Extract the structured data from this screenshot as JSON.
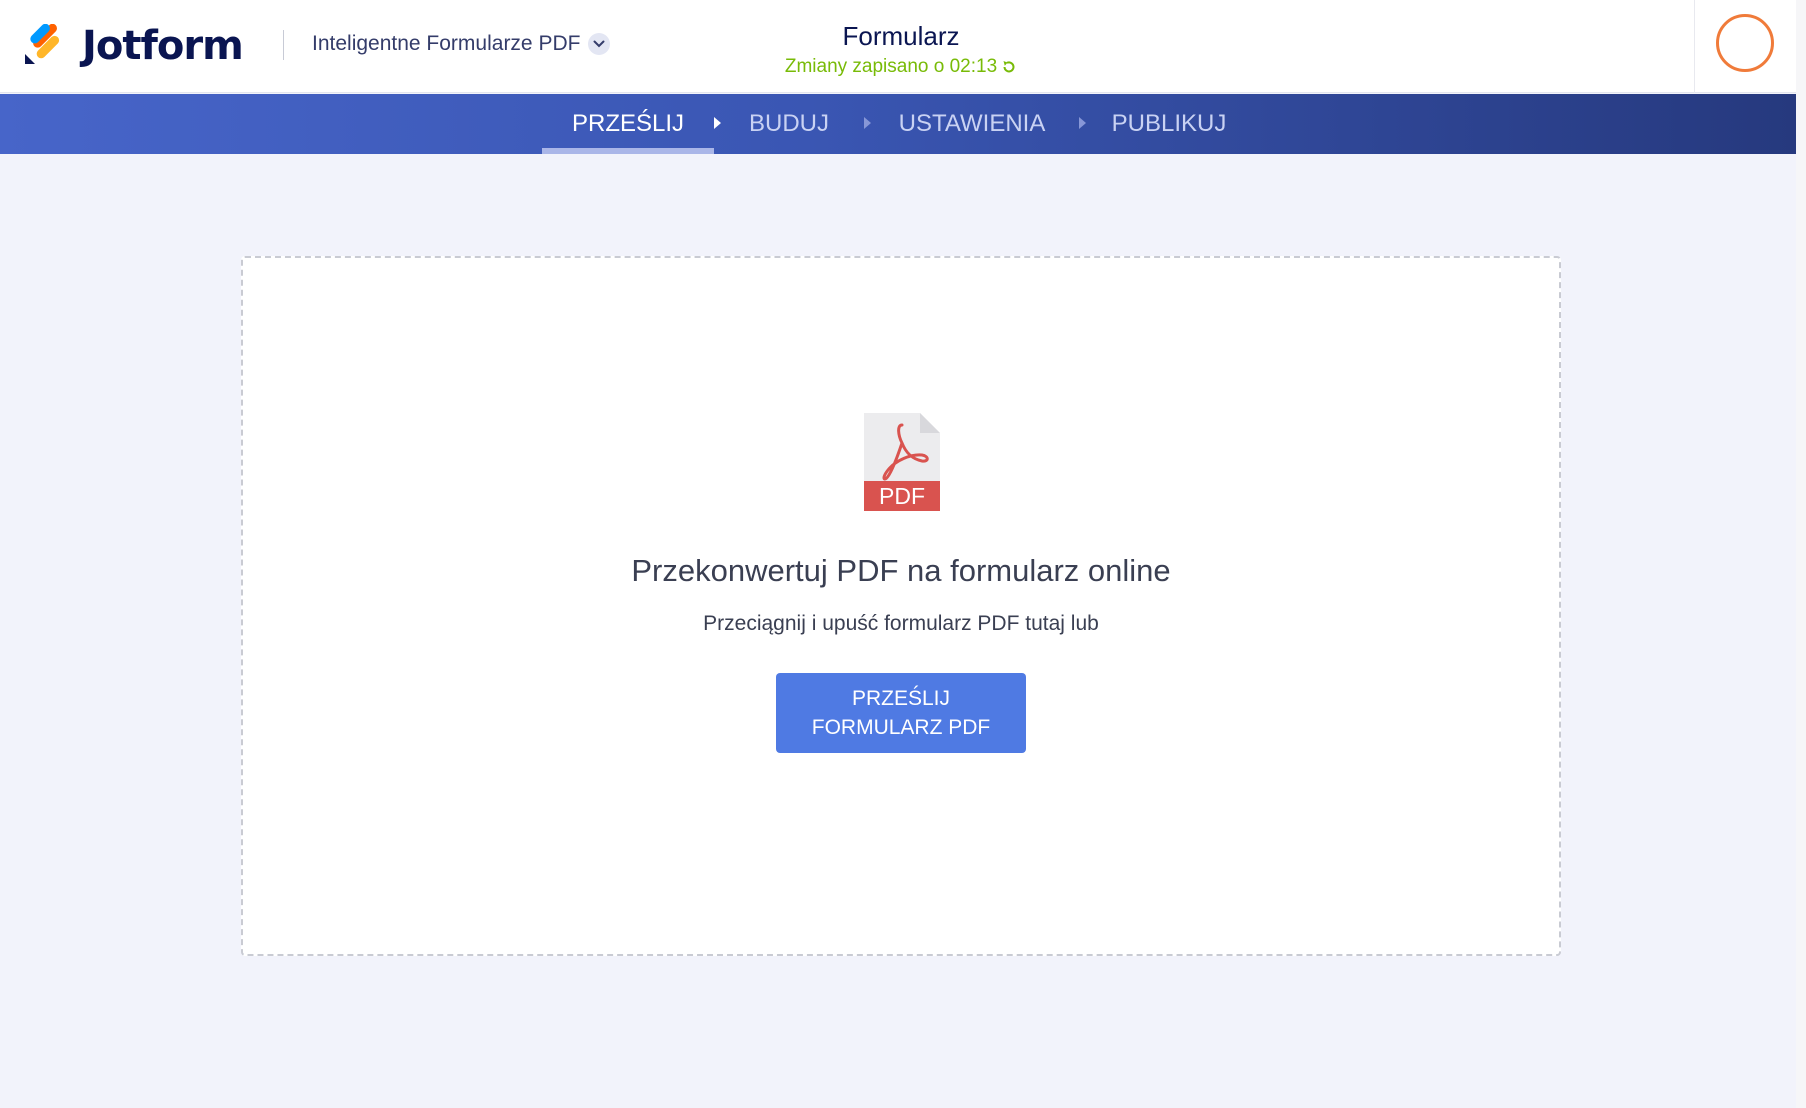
{
  "header": {
    "logo_text": "Jotform",
    "product_switcher": "Inteligentne Formularze PDF",
    "form_title": "Formularz",
    "save_status": "Zmiany zapisano o 02:13"
  },
  "nav": {
    "steps": [
      {
        "label": "PRZEŚLIJ",
        "active": true
      },
      {
        "label": "BUDUJ",
        "active": false
      },
      {
        "label": "USTAWIENIA",
        "active": false
      },
      {
        "label": "PUBLIKUJ",
        "active": false
      }
    ]
  },
  "upload": {
    "icon_label": "PDF",
    "title": "Przekonwertuj PDF na formularz online",
    "subtitle": "Przeciągnij i upuść formularz PDF tutaj lub",
    "button_line1": "PRZEŚLIJ",
    "button_line2": "FORMULARZ PDF"
  },
  "colors": {
    "brand_navy": "#0a1551",
    "accent_blue": "#4f7ae3",
    "save_green": "#78bb07",
    "avatar_orange": "#f07b3a",
    "pdf_red": "#d9534f"
  }
}
